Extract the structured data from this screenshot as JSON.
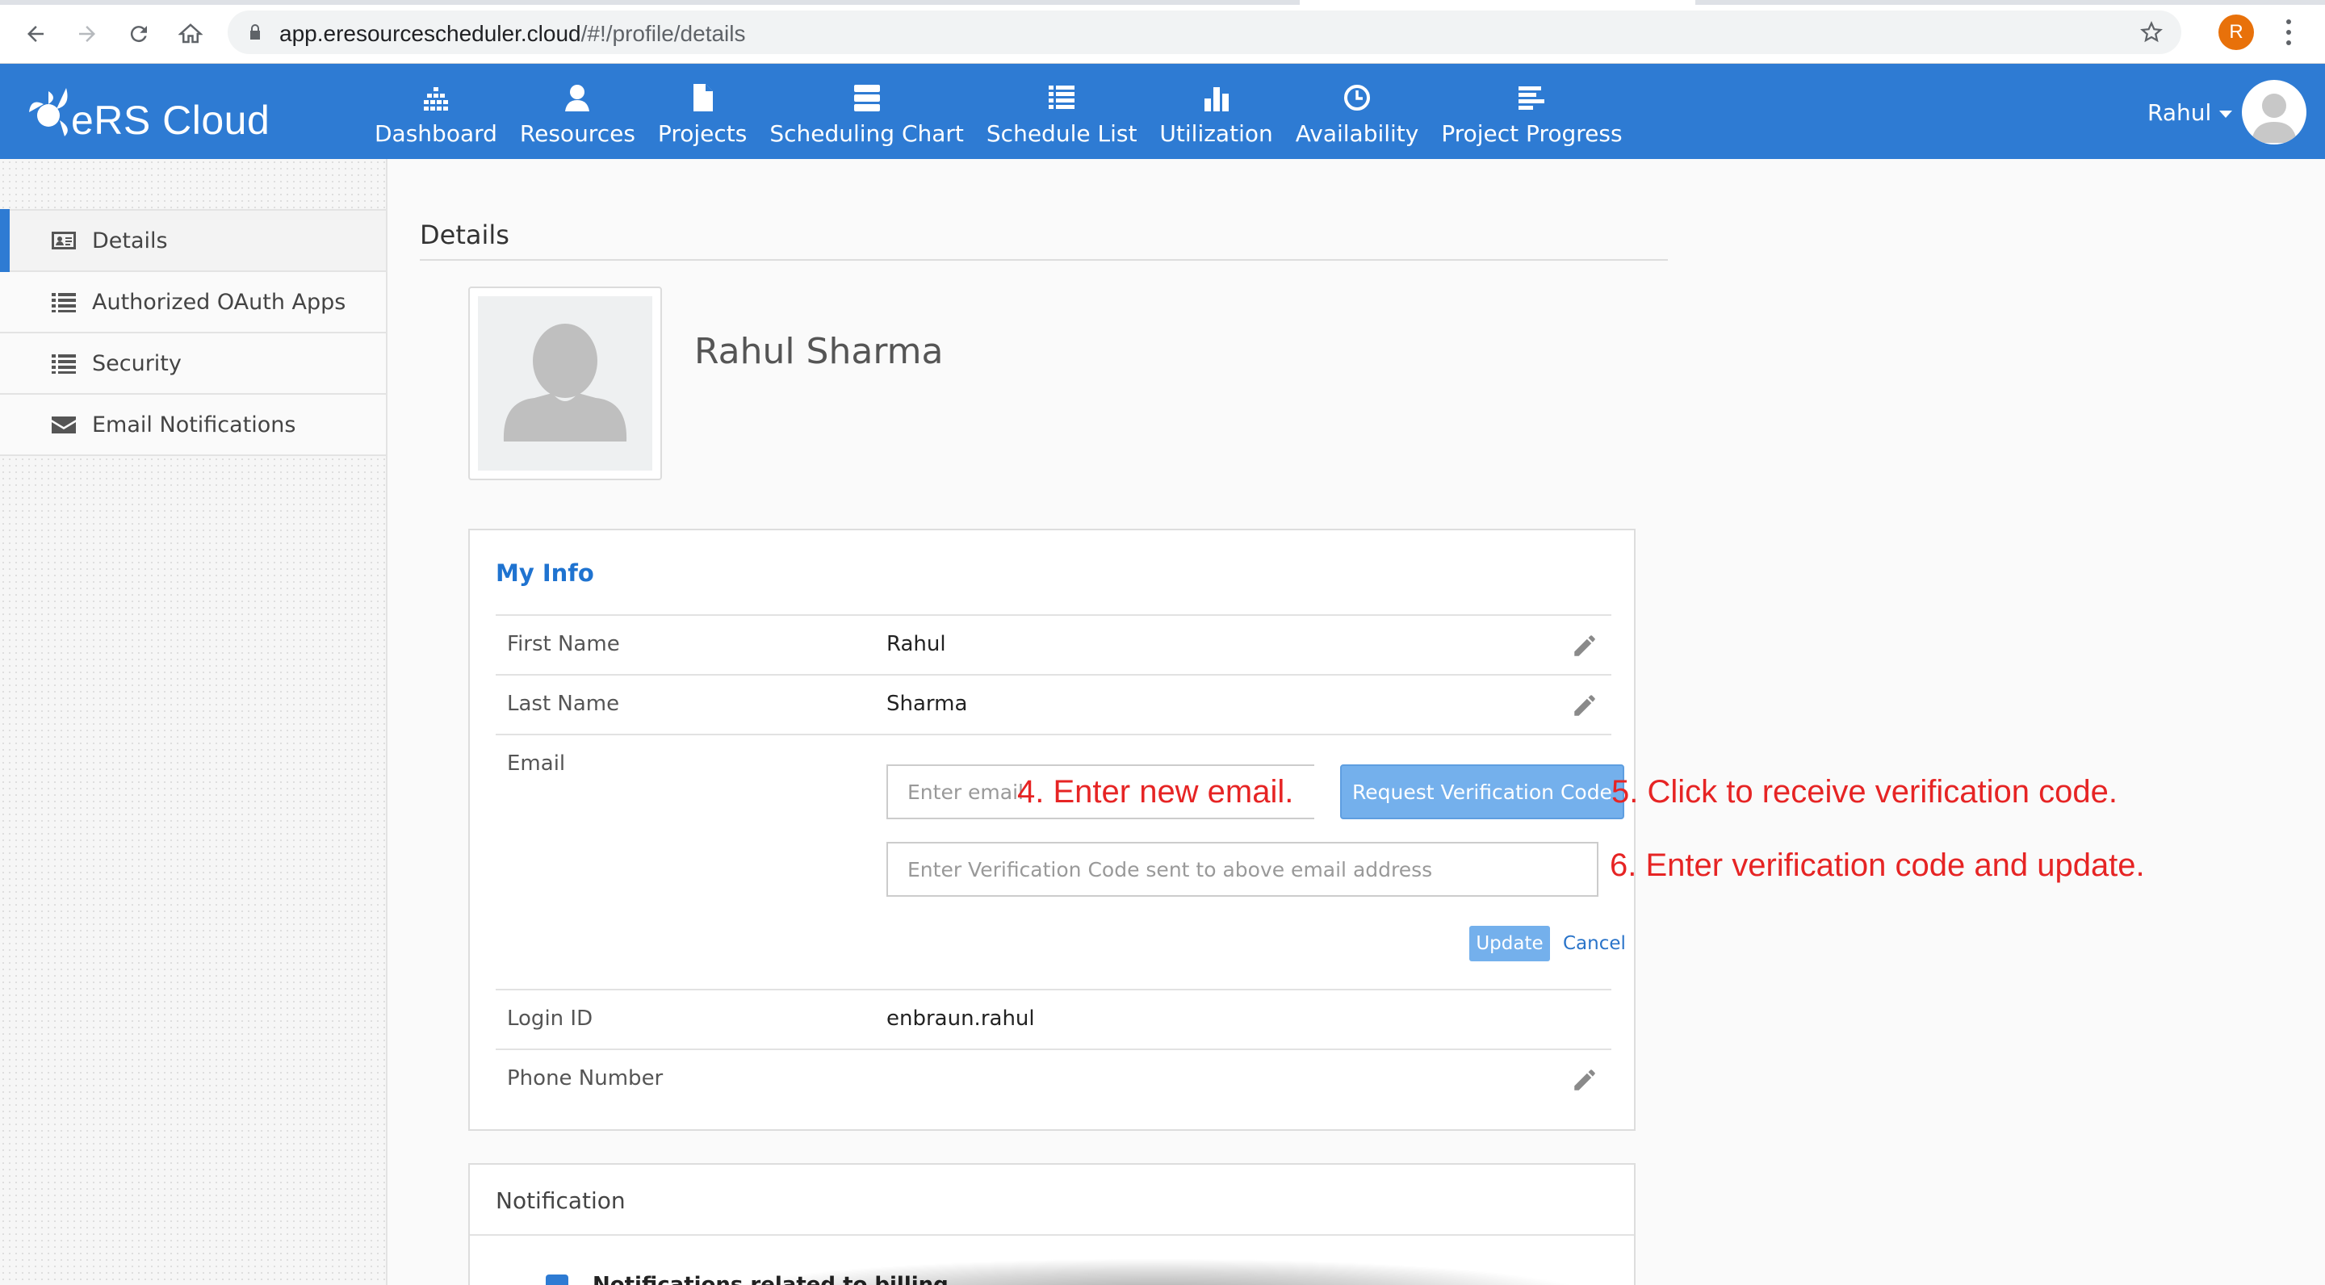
{
  "browser": {
    "url_host": "app.eresourcescheduler.cloud",
    "url_path": "/#!/profile/details",
    "profile_initial": "R"
  },
  "app": {
    "logo_text": "eRS Cloud",
    "brand_color": "#2e7bd3",
    "nav": [
      {
        "label": "Dashboard",
        "icon": "dashboard-icon"
      },
      {
        "label": "Resources",
        "icon": "person-icon"
      },
      {
        "label": "Projects",
        "icon": "file-icon"
      },
      {
        "label": "Scheduling Chart",
        "icon": "server-icon"
      },
      {
        "label": "Schedule List",
        "icon": "list-icon"
      },
      {
        "label": "Utilization",
        "icon": "bar-chart-icon"
      },
      {
        "label": "Availability",
        "icon": "clock-icon"
      },
      {
        "label": "Project Progress",
        "icon": "progress-icon"
      }
    ],
    "user_name": "Rahul"
  },
  "sidebar": {
    "items": [
      {
        "label": "Details",
        "icon": "id-card-icon",
        "active": true
      },
      {
        "label": "Authorized OAuth Apps",
        "icon": "list-icon",
        "active": false
      },
      {
        "label": "Security",
        "icon": "list-icon",
        "active": false
      },
      {
        "label": "Email Notifications",
        "icon": "envelope-icon",
        "active": false
      }
    ]
  },
  "main": {
    "title": "Details",
    "full_name": "Rahul Sharma",
    "my_info": {
      "title": "My Info",
      "first_name_label": "First Name",
      "first_name_value": "Rahul",
      "last_name_label": "Last Name",
      "last_name_value": "Sharma",
      "email_label": "Email",
      "email_placeholder": "Enter email",
      "request_button": "Request Verification Code",
      "code_placeholder": "Enter Verification Code sent to above email address",
      "update_button": "Update",
      "cancel_link": "Cancel",
      "login_id_label": "Login ID",
      "login_id_value": "enbraun.rahul",
      "phone_label": "Phone Number",
      "phone_value": ""
    },
    "notification": {
      "title": "Notification",
      "first_option": "Notifications related to billing",
      "first_option_checked": true
    }
  },
  "annotations": {
    "step4": "4. Enter new email.",
    "step5": "5. Click to receive verification code.",
    "step6": "6. Enter verification code and update.",
    "color": "#e62424"
  }
}
